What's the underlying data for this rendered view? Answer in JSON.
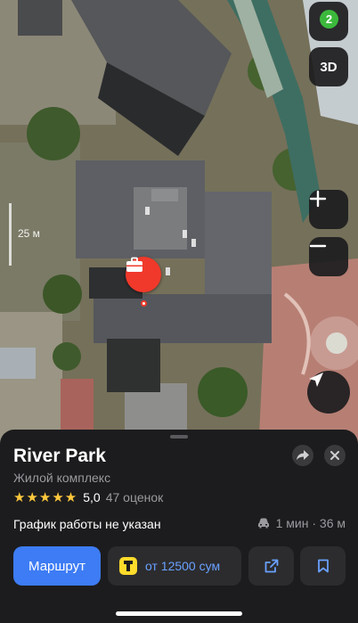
{
  "map": {
    "scale_label": "25 м",
    "layers_count": "2",
    "mode_3d_label": "3D"
  },
  "place": {
    "title": "River Park",
    "category": "Жилой комплекс",
    "stars": "★★★★★",
    "rating": "5,0",
    "reviews": "47 оценок",
    "hours": "График работы не указан",
    "travel_time": "1 мин · 36 м"
  },
  "actions": {
    "route_label": "Маршрут",
    "taxi_label": "от 12500 сум"
  },
  "colors": {
    "accent_blue": "#3d7cf4",
    "pin_red": "#f0392b",
    "star_yellow": "#ffc83d",
    "badge_green": "#3cb93c"
  }
}
